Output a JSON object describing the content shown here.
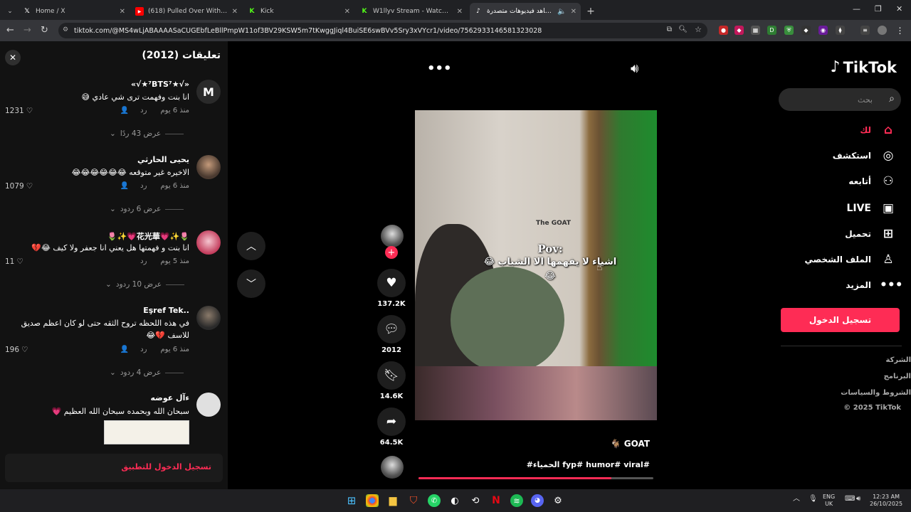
{
  "browser": {
    "tabs": [
      {
        "title": "Home / X",
        "fav": "X",
        "color": "#000000"
      },
      {
        "title": "(618) Pulled Over With LOTS Of",
        "fav": "▶",
        "color": "#ff0000"
      },
      {
        "title": "Kick",
        "fav": "K",
        "color": "#53fc18"
      },
      {
        "title": "W1llyv Stream - Watch Live on",
        "fav": "K",
        "color": "#53fc18"
      },
      {
        "title": "شاهد فيديوهات متصدرة | Tik",
        "fav": "♪",
        "color": "#000000"
      }
    ],
    "url": "tiktok.com/@MS4wLjABAAAASaCUGEbfLeBllPmpW11of3BV29KSW5m7tKwggJiql4BuiSE6swBVv5Sry3xVYcr1/video/7562933146581323028"
  },
  "comments_panel": {
    "title": "تعليقات (2012)",
    "login_prompt": "تسجيل الدخول للتطبيق",
    "comments": [
      {
        "user": "«√★⁷BTS⁷★√»",
        "text": "انا بنت وفهمت ترى شي عادي 😅",
        "time": "منذ 6 يوم",
        "reply": "رد",
        "likes": "1231",
        "replies": "عرض 43 ردًا"
      },
      {
        "user": "يحيى الحارثي",
        "text": "الاخيره غير متوقعه 😂😂😂😂😂😂",
        "time": "منذ 6 يوم",
        "reply": "رد",
        "likes": "1079",
        "replies": "عرض 6 ردود"
      },
      {
        "user": "🌷✨💗花光華💗✨🌷",
        "text": "انا بنت و فهمتها هل يعني انا جعفر ولا كيف 😂💔",
        "time": "منذ 5 يوم",
        "reply": "رد",
        "likes": "11",
        "replies": "عرض 10 ردود"
      },
      {
        "user": "Eşref Tek..",
        "text": "في هذه اللحظه تروح الثقه حتى لو كان اعظم صديق للاسف 💔😂",
        "time": "منذ 6 يوم",
        "reply": "رد",
        "likes": "196",
        "replies": "عرض 4 ردود"
      },
      {
        "user": "ءآل عوضه",
        "text": "سبحان الله وبحمده سبحان الله العظيم 💗",
        "time": "",
        "reply": "",
        "likes": "",
        "replies": ""
      }
    ]
  },
  "video": {
    "logo_text": "The GOAT",
    "caption_pov": "Pov:",
    "caption_text": "اشياء لا يفهمها الا الشباب 😂😂",
    "author": "🐐 GOAT",
    "tags": "#الحمياء fyp# humor# viral#",
    "progress": 0.82,
    "actions": {
      "likes": "137.2K",
      "comments": "2012",
      "saves": "14.6K",
      "shares": "64.5K"
    }
  },
  "sidebar": {
    "brand": "TikTok",
    "search_placeholder": "بحث",
    "nav": [
      {
        "label": "لك",
        "icon": "home-icon"
      },
      {
        "label": "استكشف",
        "icon": "compass-icon"
      },
      {
        "label": "أتابعه",
        "icon": "following-icon"
      },
      {
        "label": "LIVE",
        "icon": "live-icon"
      },
      {
        "label": "تحميل",
        "icon": "upload-icon"
      },
      {
        "label": "الملف الشخصي",
        "icon": "profile-icon"
      },
      {
        "label": "المزيد",
        "icon": "more-icon"
      }
    ],
    "login_button": "تسجيل الدخول",
    "footer": [
      "الشركة",
      "البرنامج",
      "الشروط والسياسات",
      "© 2025 TikTok"
    ]
  },
  "taskbar": {
    "lang_top": "ENG",
    "lang_bottom": "UK",
    "time": "12:23 AM",
    "date": "26/10/2025"
  }
}
